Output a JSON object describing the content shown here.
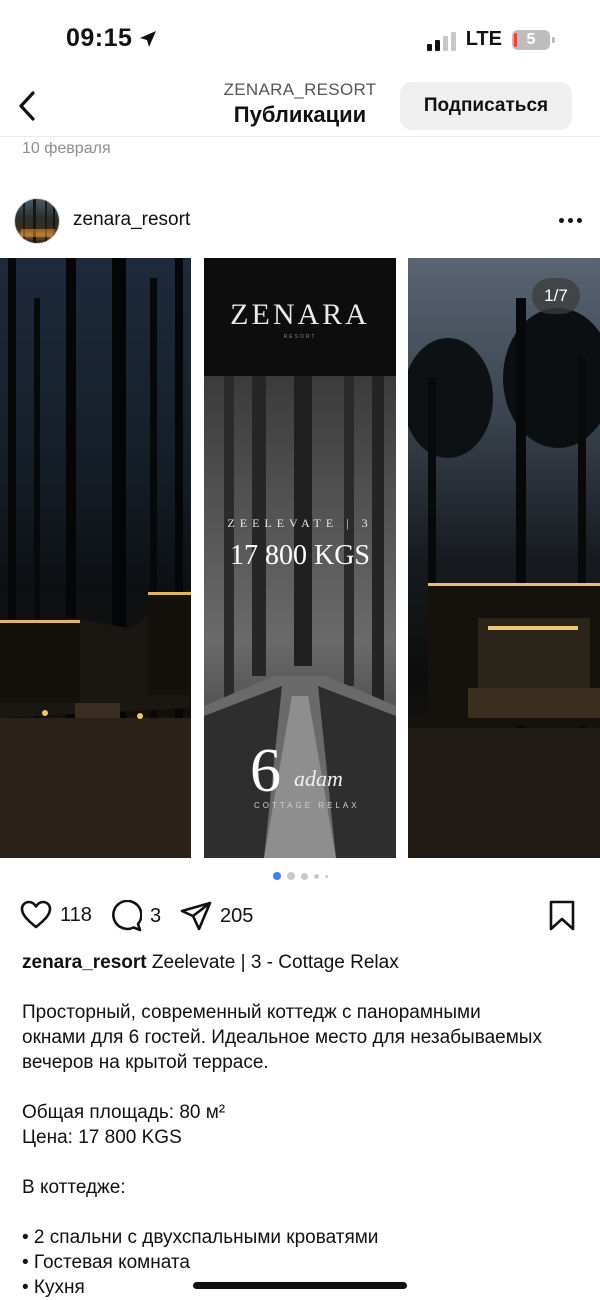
{
  "status_bar": {
    "time": "09:15",
    "network": "LTE",
    "battery": "5"
  },
  "header": {
    "account": "ZENARA_RESORT",
    "title": "Публикации",
    "subscribe_label": "Подписаться"
  },
  "post": {
    "date": "10 февраля",
    "username": "zenara_resort",
    "carousel": {
      "counter": "1/7",
      "logo": "ZENARA",
      "logo_sub": "RESORT",
      "slide_name": "ZEELEVATE | 3",
      "price": "17 800 KGS",
      "guests_number": "6",
      "guests_word": "adam",
      "cottage_tag": "COTTAGE RELAX",
      "dot_count": 5,
      "active_dot": 0
    },
    "likes": "118",
    "comments": "3",
    "shares": "205",
    "caption": {
      "username": "zenara_resort",
      "headline": " Zeelevate | 3 - Cottage Relax",
      "lines": [
        "",
        "Просторный, современный коттедж с панорамными",
        "окнами для 6 гостей. Идеальное место для незабываемых",
        "вечеров на крытой террасе.",
        "",
        "Общая площадь: 80 м²",
        "Цена: 17 800 KGS",
        "",
        "В коттедже:",
        "",
        "• 2 спальни с двухспальными кроватями",
        "• Гостевая комната",
        "• Кухня"
      ]
    }
  }
}
